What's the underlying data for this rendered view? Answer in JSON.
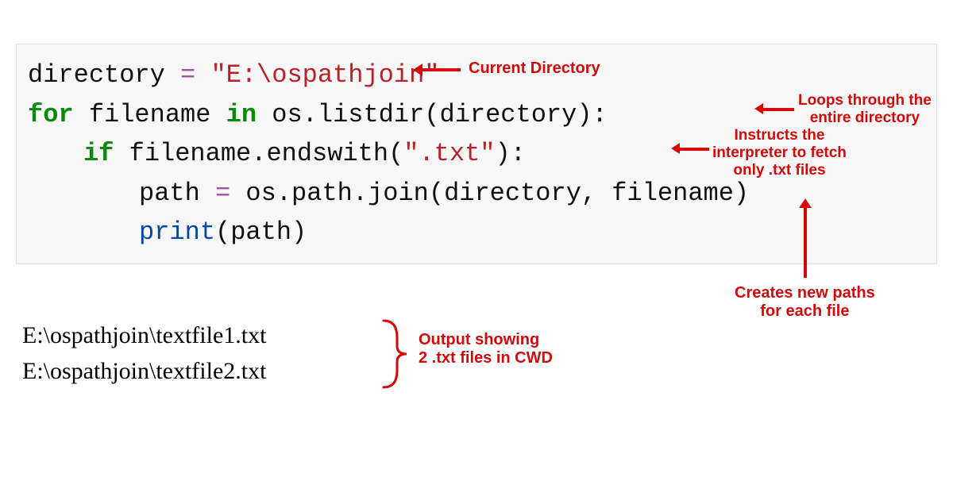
{
  "code": {
    "line1": {
      "a": "directory ",
      "op": "=",
      "b": " ",
      "str": "\"E:\\ospathjoin\""
    },
    "line2": {
      "kw1": "for",
      "a": " filename ",
      "kw2": "in",
      "b": " os.listdir(directory):"
    },
    "line3": {
      "kw": "if",
      "a": " filename.endswith(",
      "str": "\".txt\"",
      "b": "):"
    },
    "line4": {
      "a": "path ",
      "op": "=",
      "b": " os.path.join(directory, filename)"
    },
    "line5": {
      "func": "print",
      "a": "(path)"
    }
  },
  "output": {
    "line1": "E:\\ospathjoin\\textfile1.txt",
    "line2": "E:\\ospathjoin\\textfile2.txt"
  },
  "annotations": {
    "current_dir": "Current Directory",
    "loops": "Loops through the\nentire directory",
    "instructs": "Instructs the\ninterpreter to fetch\nonly .txt files",
    "creates": "Creates new paths\nfor each file",
    "output_note": "Output showing\n2 .txt files in CWD"
  },
  "colors": {
    "annotation": "#d40a0a",
    "keyword": "#0a8a0a",
    "string": "#ba2126",
    "operator": "#a64ca6",
    "code_bg": "#f7f7f7"
  }
}
